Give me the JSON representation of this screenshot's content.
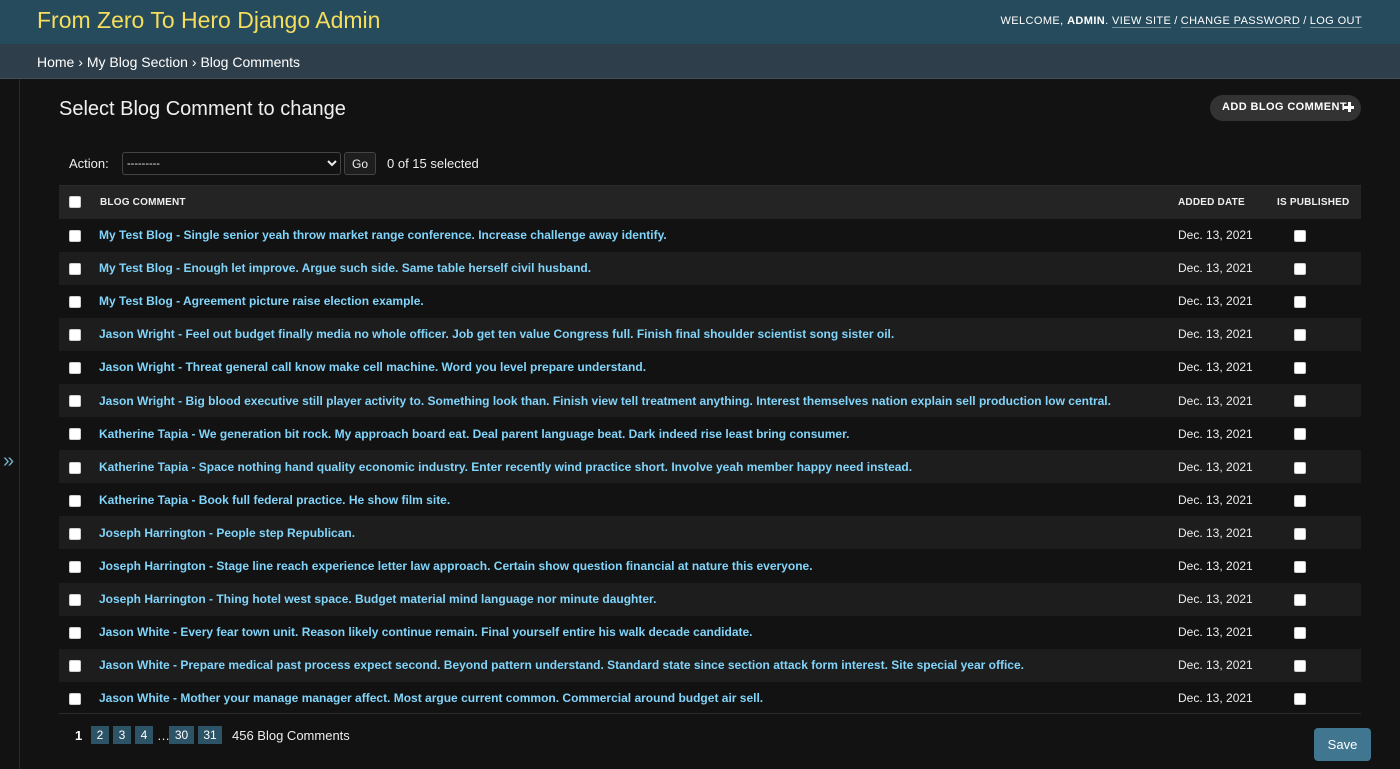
{
  "header": {
    "site_name": "From Zero To Hero Django Admin",
    "welcome": "WELCOME,",
    "username": "ADMIN",
    "view_site": "VIEW SITE",
    "change_password": "CHANGE PASSWORD",
    "log_out": "LOG OUT",
    "separator": "/"
  },
  "breadcrumbs": {
    "home": "Home",
    "section": "My Blog Section",
    "current": "Blog Comments",
    "separator": "›"
  },
  "nav_toggle": "»",
  "page": {
    "title": "Select Blog Comment to change",
    "add_button": "ADD BLOG COMMENT"
  },
  "actions": {
    "label": "Action:",
    "selected_option": "---------",
    "go": "Go",
    "counter": "0 of 15 selected"
  },
  "table": {
    "headers": {
      "comment": "BLOG COMMENT",
      "date": "ADDED DATE",
      "published": "IS PUBLISHED"
    },
    "rows": [
      {
        "comment": "My Test Blog - Single senior yeah throw market range conference. Increase challenge away identify.",
        "date": "Dec. 13, 2021",
        "published": false
      },
      {
        "comment": "My Test Blog - Enough let improve. Argue such side. Same table herself civil husband.",
        "date": "Dec. 13, 2021",
        "published": false
      },
      {
        "comment": "My Test Blog - Agreement picture raise election example.",
        "date": "Dec. 13, 2021",
        "published": false
      },
      {
        "comment": "Jason Wright - Feel out budget finally media no whole officer. Job get ten value Congress full. Finish final shoulder scientist song sister oil.",
        "date": "Dec. 13, 2021",
        "published": false
      },
      {
        "comment": "Jason Wright - Threat general call know make cell machine. Word you level prepare understand.",
        "date": "Dec. 13, 2021",
        "published": false
      },
      {
        "comment": "Jason Wright - Big blood executive still player activity to. Something look than. Finish view tell treatment anything. Interest themselves nation explain sell production low central.",
        "date": "Dec. 13, 2021",
        "published": false
      },
      {
        "comment": "Katherine Tapia - We generation bit rock. My approach board eat. Deal parent language beat. Dark indeed rise least bring consumer.",
        "date": "Dec. 13, 2021",
        "published": false
      },
      {
        "comment": "Katherine Tapia - Space nothing hand quality economic industry. Enter recently wind practice short. Involve yeah member happy need instead.",
        "date": "Dec. 13, 2021",
        "published": false
      },
      {
        "comment": "Katherine Tapia - Book full federal practice. He show film site.",
        "date": "Dec. 13, 2021",
        "published": false
      },
      {
        "comment": "Joseph Harrington - People step Republican.",
        "date": "Dec. 13, 2021",
        "published": false
      },
      {
        "comment": "Joseph Harrington - Stage line reach experience letter law approach. Certain show question financial at nature this everyone.",
        "date": "Dec. 13, 2021",
        "published": false
      },
      {
        "comment": "Joseph Harrington - Thing hotel west space. Budget material mind language nor minute daughter.",
        "date": "Dec. 13, 2021",
        "published": false
      },
      {
        "comment": "Jason White - Every fear town unit. Reason likely continue remain. Final yourself entire his walk decade candidate.",
        "date": "Dec. 13, 2021",
        "published": false
      },
      {
        "comment": "Jason White - Prepare medical past process expect second. Beyond pattern understand. Standard state since section attack form interest. Site special year office.",
        "date": "Dec. 13, 2021",
        "published": false
      },
      {
        "comment": "Jason White - Mother your manage manager affect. Most argue current common. Commercial around budget air sell.",
        "date": "Dec. 13, 2021",
        "published": false
      }
    ]
  },
  "pagination": {
    "current": "1",
    "pages": [
      "2",
      "3",
      "4",
      "30",
      "31"
    ],
    "ellipsis": "…",
    "total": "456 Blog Comments"
  },
  "save_button": "Save"
}
